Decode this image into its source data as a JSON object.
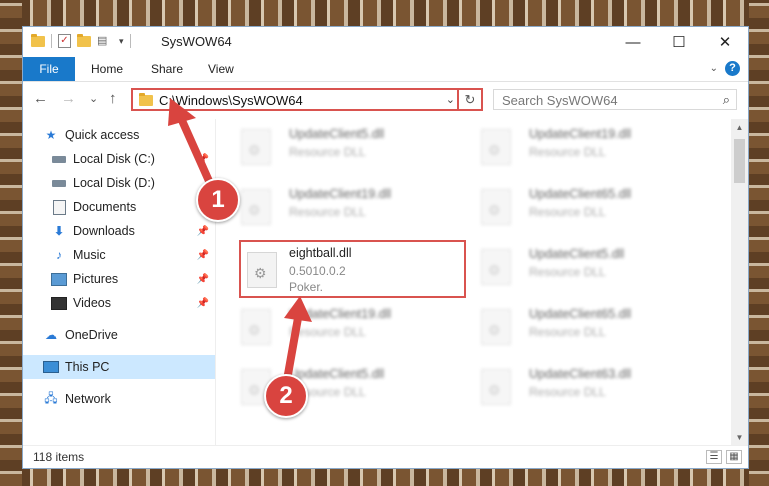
{
  "window": {
    "title": "SysWOW64",
    "minimize": "—",
    "maximize": "☐",
    "close": "✕"
  },
  "ribbon": {
    "file": "File",
    "tabs": [
      "Home",
      "Share",
      "View"
    ],
    "help": "?"
  },
  "navigation": {
    "back": "←",
    "forward": "→",
    "recent": "⌄",
    "up": "↑",
    "address": "C:\\Windows\\SysWOW64",
    "search_placeholder": "Search SysWOW64"
  },
  "sidebar": {
    "items": [
      {
        "label": "Quick access",
        "icon": "star-icon"
      },
      {
        "label": "Local Disk (C:)",
        "icon": "drive-icon",
        "pinned": true
      },
      {
        "label": "Local Disk (D:)",
        "icon": "drive-icon"
      },
      {
        "label": "Documents",
        "icon": "documents-icon"
      },
      {
        "label": "Downloads",
        "icon": "download-icon",
        "pinned": true
      },
      {
        "label": "Music",
        "icon": "music-icon",
        "pinned": true
      },
      {
        "label": "Pictures",
        "icon": "pictures-icon",
        "pinned": true
      },
      {
        "label": "Videos",
        "icon": "videos-icon",
        "pinned": true
      },
      {
        "label": "OneDrive",
        "icon": "cloud-icon"
      },
      {
        "label": "This PC",
        "icon": "computer-icon",
        "selected": true
      },
      {
        "label": "Network",
        "icon": "network-icon"
      }
    ]
  },
  "files": {
    "left": [
      {
        "name": "UpdateClient5.dll",
        "sub": "Resource DLL"
      },
      {
        "name": "UpdateClient19.dll",
        "sub": "Resource DLL"
      },
      {
        "name": "eightball.dll",
        "sub": "0.5010.0.2",
        "sub2": "Poker."
      },
      {
        "name": "UpdateClient19.dll",
        "sub": "Resource DLL"
      },
      {
        "name": "UpdateClient5.dll",
        "sub": "Resource DLL"
      }
    ],
    "right": [
      {
        "name": "UpdateClient19.dll",
        "sub": "Resource DLL"
      },
      {
        "name": "UpdateClient65.dll",
        "sub": "Resource DLL"
      },
      {
        "name": "UpdateClient5.dll",
        "sub": "Resource DLL"
      },
      {
        "name": "UpdateClient65.dll",
        "sub": "Resource DLL"
      },
      {
        "name": "UpdateClient63.dll",
        "sub": "Resource DLL"
      }
    ]
  },
  "status": {
    "count": "118 items"
  },
  "annotations": {
    "step1": "1",
    "step2": "2",
    "accent": "#d9443f"
  }
}
